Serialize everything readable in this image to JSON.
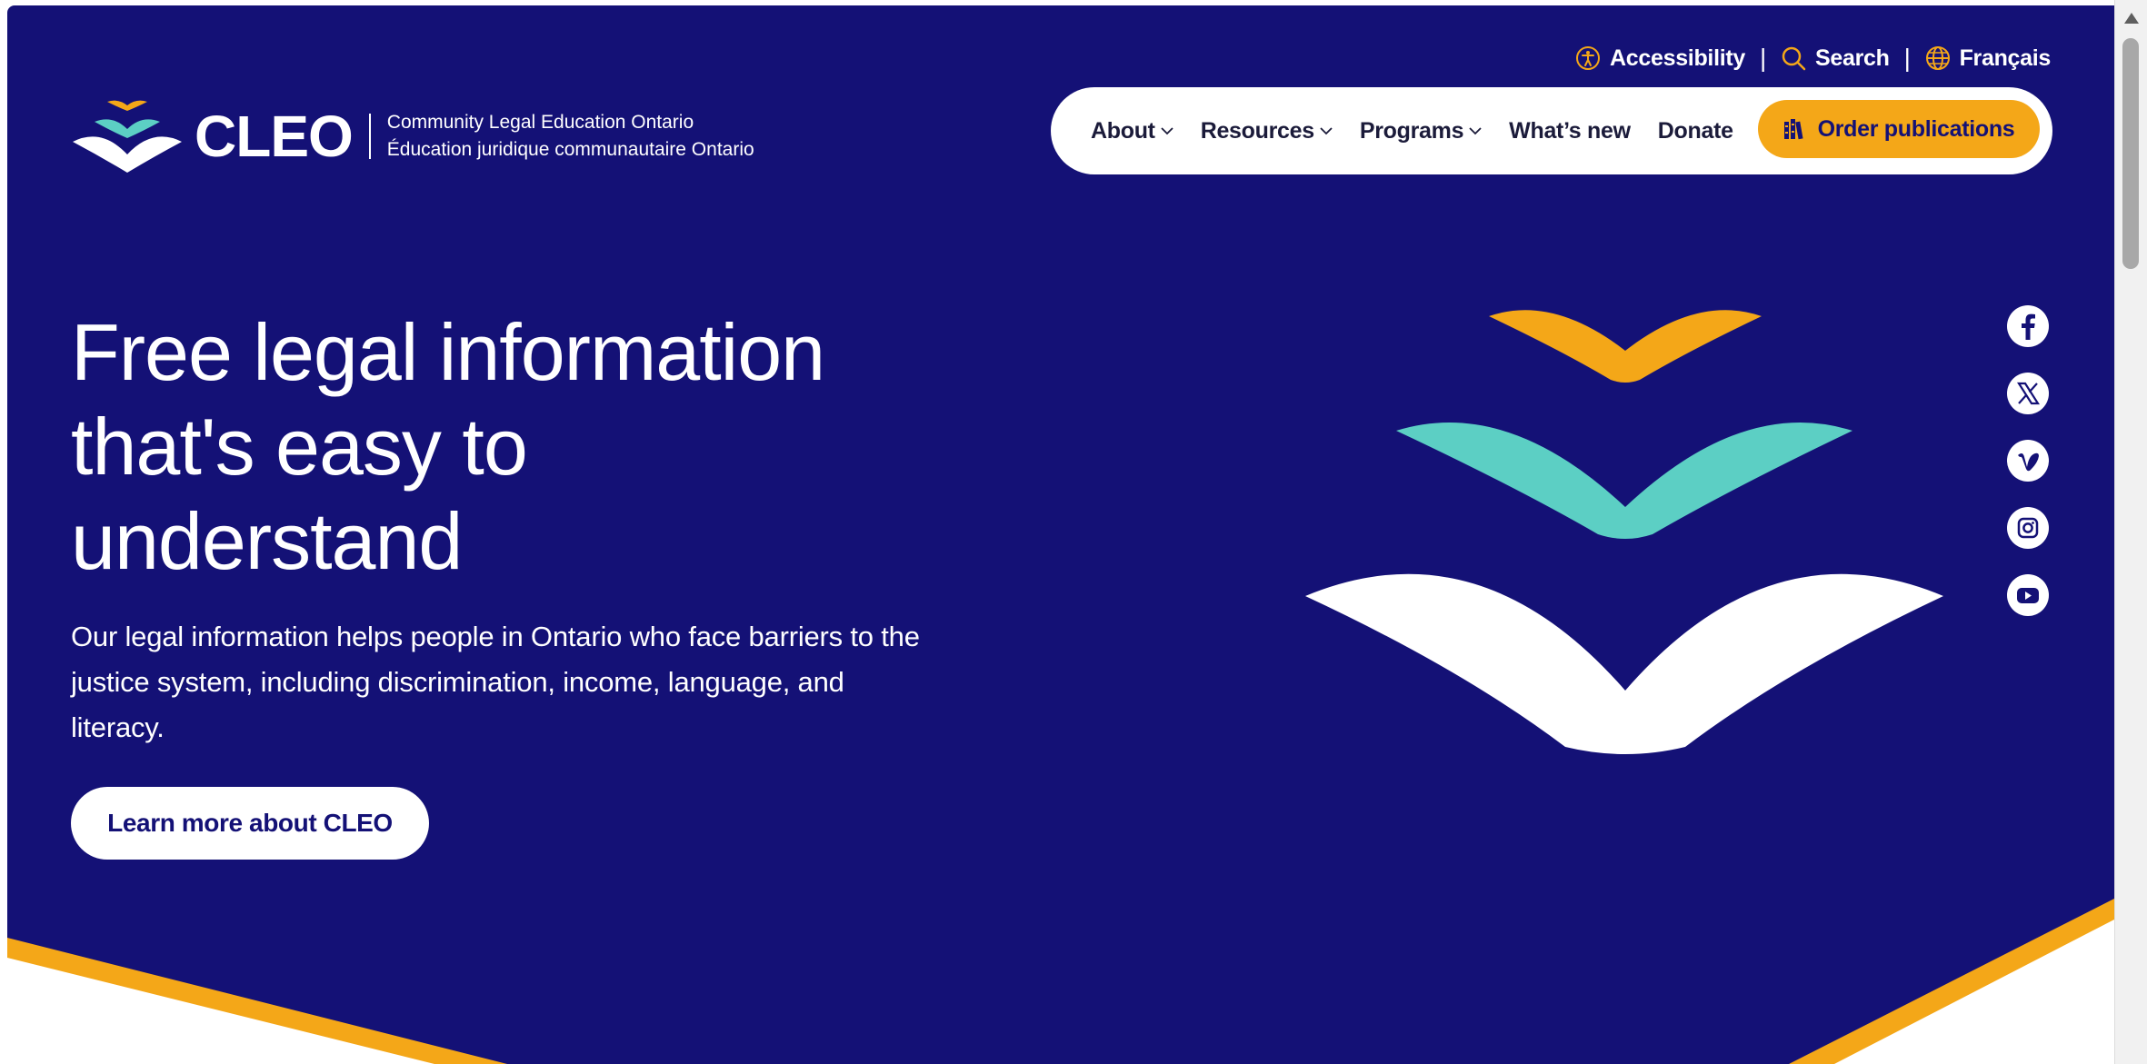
{
  "utility": {
    "accessibility": "Accessibility",
    "search": "Search",
    "language": "Français",
    "separator": "|"
  },
  "logo": {
    "wordmark": "CLEO",
    "line1": "Community Legal Education Ontario",
    "line2": "Éducation juridique communautaire Ontario"
  },
  "nav": {
    "items": [
      {
        "label": "About",
        "has_dropdown": true
      },
      {
        "label": "Resources",
        "has_dropdown": true
      },
      {
        "label": "Programs",
        "has_dropdown": true
      },
      {
        "label": "What’s new",
        "has_dropdown": false
      },
      {
        "label": "Donate",
        "has_dropdown": false
      }
    ],
    "order_button": "Order publications"
  },
  "hero": {
    "headline_line1": "Free legal information",
    "headline_line2": "that's easy to",
    "headline_line3": "understand",
    "intro": "Our legal information helps people in Ontario who face barriers to the justice system, including discrimination, income, language, and literacy.",
    "cta": "Learn more about CLEO"
  },
  "social": [
    "facebook-icon",
    "x-icon",
    "vimeo-icon",
    "instagram-icon",
    "youtube-icon"
  ],
  "colors": {
    "navy": "#141176",
    "gold": "#f4a718",
    "teal": "#5ccfc4",
    "white": "#ffffff"
  }
}
